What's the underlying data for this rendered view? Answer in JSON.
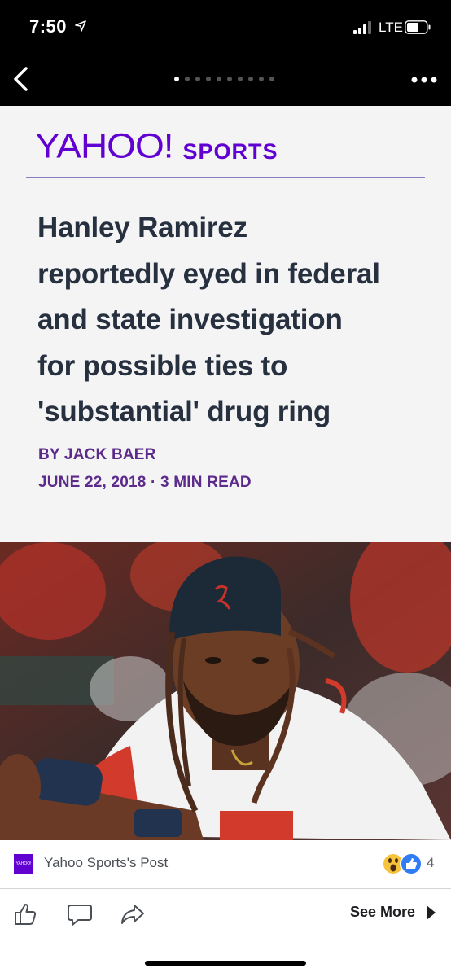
{
  "status_bar": {
    "time": "7:50",
    "network": "LTE",
    "icons": [
      "location-arrow-icon",
      "signal-icon",
      "battery-icon"
    ]
  },
  "nav_bar": {
    "back_icon": "chevron-left-icon",
    "more_icon": "ellipsis-icon",
    "page_count": 10,
    "active_page": 1
  },
  "article": {
    "logo_main": "YAHOO!",
    "logo_sub": "SPORTS",
    "headline_lines": [
      "Hanley Ramirez",
      "reportedly eyed in federal",
      "and state investigation",
      "for possible ties to",
      "'substantial' drug ring"
    ],
    "byline": "BY JACK BAER",
    "dateline": "JUNE 22, 2018 · 3 MIN READ",
    "brand_color": "#6001d2",
    "headline_color": "#27303f",
    "byline_color": "#5b2a8a"
  },
  "photo": {
    "alt_icon": "player-photo"
  },
  "post": {
    "avatar_text": "YAHOO! SPORTS",
    "title": "Yahoo Sports's Post",
    "reaction_icons": [
      "wow-reaction-icon",
      "like-reaction-icon"
    ],
    "reaction_count": "4"
  },
  "actions": {
    "like_icon": "thumbs-up-icon",
    "comment_icon": "comment-icon",
    "share_icon": "share-icon",
    "see_more": "See More"
  }
}
